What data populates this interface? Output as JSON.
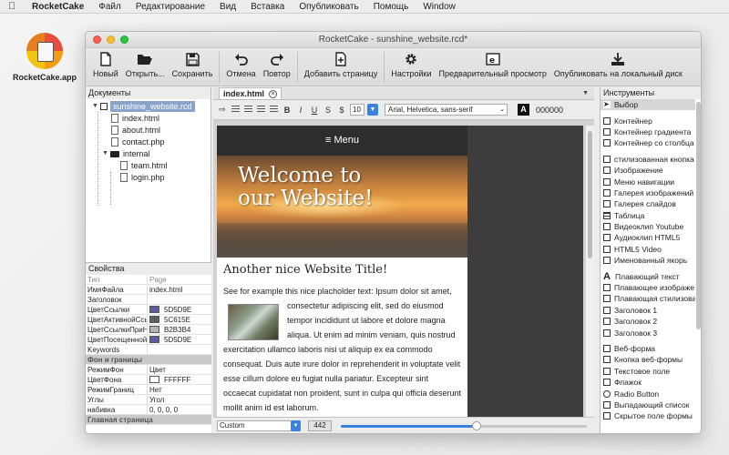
{
  "menubar": {
    "app": "RocketCake",
    "items": [
      "Файл",
      "Редактирование",
      "Вид",
      "Вставка",
      "Опубликовать",
      "Помощь",
      "Window"
    ]
  },
  "desktop": {
    "icon_label": "RocketCake.app"
  },
  "window": {
    "title": "RocketCake - sunshine_website.rcd*"
  },
  "toolbar": {
    "new": "Новый",
    "open": "Открыть...",
    "save": "Сохранить",
    "undo": "Отмена",
    "redo": "Повтор",
    "add_page": "Добавить страницу",
    "settings": "Настройки",
    "preview": "Предварительный просмотр",
    "publish": "Опубликовать на локальный диск"
  },
  "documents": {
    "title": "Документы",
    "root": "sunshine_website.rcd",
    "files": [
      "index.html",
      "about.html",
      "contact.php"
    ],
    "folder": "internal",
    "subfiles": [
      "team.html",
      "login.php"
    ]
  },
  "properties": {
    "title": "Свойства",
    "col_type": "Тип",
    "col_type_value": "Page",
    "rows": [
      {
        "k": "ИмяФайла",
        "v": "index.html"
      },
      {
        "k": "Заголовок",
        "v": ""
      },
      {
        "k": "ЦветСсылки",
        "v": "5D5D9E",
        "color": "#5D5D9E"
      },
      {
        "k": "ЦветАктивнойСсы",
        "v": "5C615E",
        "color": "#5C615E"
      },
      {
        "k": "ЦветСсылкиПриНа",
        "v": "B2B3B4",
        "color": "#B2B3B4"
      },
      {
        "k": "ЦветПосещенной",
        "v": "5D5D9E",
        "color": "#5D5D9E"
      },
      {
        "k": "Keywords",
        "v": ""
      }
    ],
    "section_bg": "Фон и границы",
    "bg_rows": [
      {
        "k": "РежимФон",
        "v": "Цвет"
      },
      {
        "k": "ЦветФона",
        "v": "FFFFFF",
        "color": "#FFFFFF"
      },
      {
        "k": "РежимГраниц",
        "v": "Нет"
      },
      {
        "k": "Углы",
        "v": "Угол"
      },
      {
        "k": "набивка",
        "v": "0, 0, 0, 0"
      }
    ],
    "section_main": "Главная страница"
  },
  "editor": {
    "tab": "index.html",
    "font_size": "10",
    "font_family": "Arial, Helvetica, sans-serif",
    "color_letter": "A",
    "color_value": "000000"
  },
  "page": {
    "nav": "≡ Menu",
    "hero_title": "Welcome to\nour Website!",
    "heading": "Another nice Website Title!",
    "para_start": "See for example this nice placholder text: Ipsum dolor sit amet,",
    "para_rest": "consectetur adipiscing elit, sed do eiusmod tempor incididunt ut labore et dolore magna aliqua. Ut enim ad minim veniam, quis nostrud exercitation ullamco laboris nisi ut aliquip ex ea commodo consequat. Duis aute irure dolor in reprehenderit in voluptate velit esse cillum dolore eu fugiat nulla pariatur. Excepteur sint occaecat cupidatat non proident, sunt in culpa qui officia deserunt mollit anim id est laborum."
  },
  "bottom": {
    "size_select": "Custom",
    "width_value": "442",
    "slider_fraction": 0.55
  },
  "tools": {
    "title": "Инструменты",
    "select": "Выбор",
    "group1": [
      "Контейнер",
      "Контейнер градиента",
      "Контейнер со столбца"
    ],
    "group2": [
      "стилизованная кнопка",
      "Изображение",
      "Меню навигации",
      "Галерея изображений",
      "Галерея слайдов",
      "Таблица",
      "Видеоклип Youtube",
      "Аудиоклип HTML5",
      "HTML5 Video",
      "Именованный якорь"
    ],
    "group3": [
      "Плавающий текст",
      "Плавающее изображе",
      "Плавающая стилизова",
      "Заголовок 1",
      "Заголовок 2",
      "Заголовок 3"
    ],
    "group4": [
      "Веб-форма",
      "Кнопка веб-формы",
      "Текстовое поле",
      "Флажок",
      "Radio Button",
      "Выпадающий список",
      "Скрытое поле формы"
    ]
  }
}
